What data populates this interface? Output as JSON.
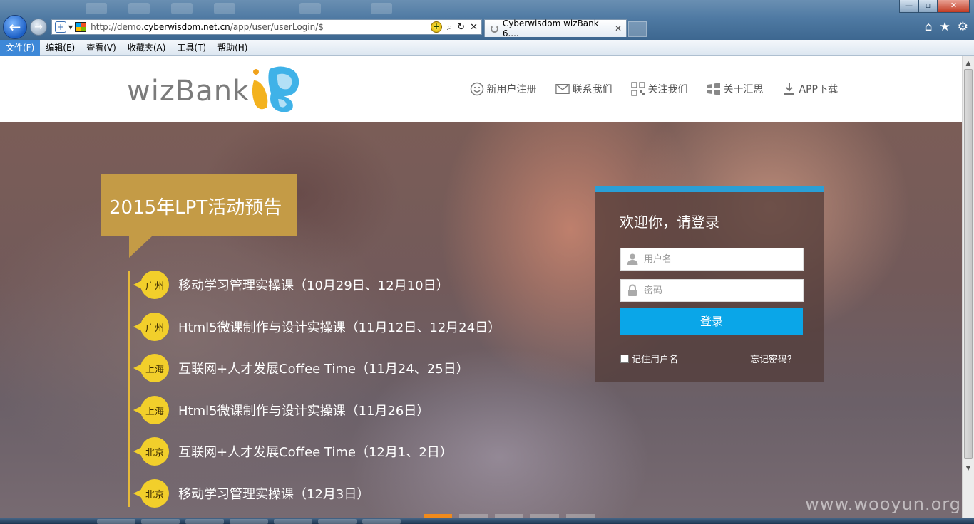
{
  "browser": {
    "url_prefix": "http://demo.",
    "url_domain": "cyberwisdom.net.cn",
    "url_path": "/app/user/userLogin/$",
    "tab_title": "Cyberwisdom wizBank 6....",
    "menu": [
      "文件(F)",
      "编辑(E)",
      "查看(V)",
      "收藏夹(A)",
      "工具(T)",
      "帮助(H)"
    ]
  },
  "header": {
    "logo_text": "wizBank",
    "nav": [
      {
        "label": "新用户注册",
        "icon": "smiley-icon"
      },
      {
        "label": "联系我们",
        "icon": "envelope-icon"
      },
      {
        "label": "关注我们",
        "icon": "qr-code-icon"
      },
      {
        "label": "关于汇思",
        "icon": "windows-icon"
      },
      {
        "label": "APP下载",
        "icon": "download-icon"
      }
    ]
  },
  "events": {
    "title": "2015年LPT活动预告",
    "items": [
      {
        "city": "广州",
        "text": "移动学习管理实操课（10月29日、12月10日）"
      },
      {
        "city": "广州",
        "text": "Html5微课制作与设计实操课（11月12日、12月24日）"
      },
      {
        "city": "上海",
        "text": "互联网+人才发展Coffee Time（11月24、25日）"
      },
      {
        "city": "上海",
        "text": "Html5微课制作与设计实操课（11月26日）"
      },
      {
        "city": "北京",
        "text": "互联网+人才发展Coffee Time（12月1、2日）"
      },
      {
        "city": "北京",
        "text": "移动学习管理实操课（12月3日）"
      }
    ]
  },
  "login": {
    "title": "欢迎你，请登录",
    "username_placeholder": "用户名",
    "password_placeholder": "密码",
    "submit_label": "登录",
    "remember_label": "记住用户名",
    "forgot_label": "忘记密码？"
  },
  "colors": {
    "accent_blue": "#0aa6e8",
    "event_gold": "#c49b46",
    "badge_yellow": "#f2cf2b",
    "slider_active": "#f08a1c"
  },
  "watermark": "www.wooyun.org"
}
